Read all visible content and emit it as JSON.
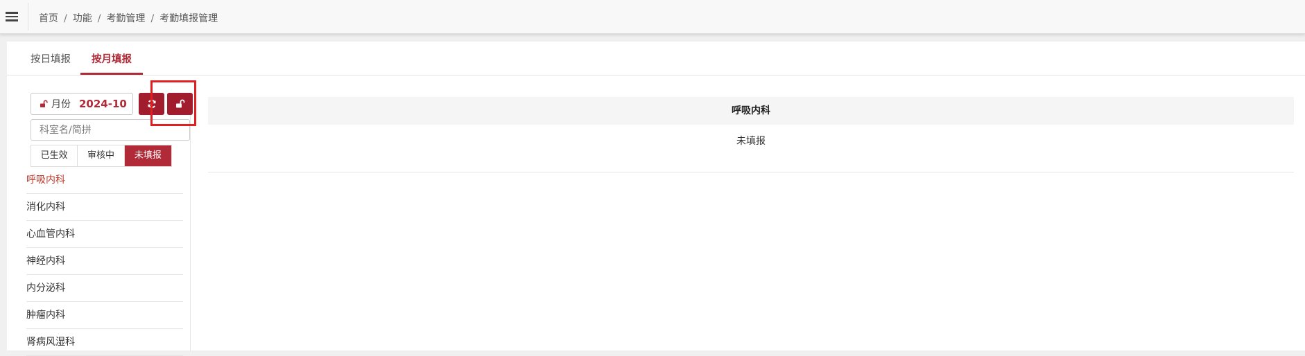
{
  "breadcrumb": [
    "首页",
    "功能",
    "考勤管理",
    "考勤填报管理"
  ],
  "tabs": [
    "按日填报",
    "按月填报"
  ],
  "month": {
    "label": "月份",
    "value": "2024-10"
  },
  "search": {
    "placeholder": "科室名/简拼"
  },
  "status_filters": [
    "已生效",
    "审核中",
    "未填报"
  ],
  "departments": [
    "呼吸内科",
    "消化内科",
    "心血管内科",
    "神经内科",
    "内分泌科",
    "肿瘤内科",
    "肾病风湿科"
  ],
  "detail": {
    "department": "呼吸内科",
    "status": "未填报"
  },
  "colors": {
    "accent": "#b02a37",
    "button": "#a11c2c",
    "highlight": "#e02020"
  }
}
